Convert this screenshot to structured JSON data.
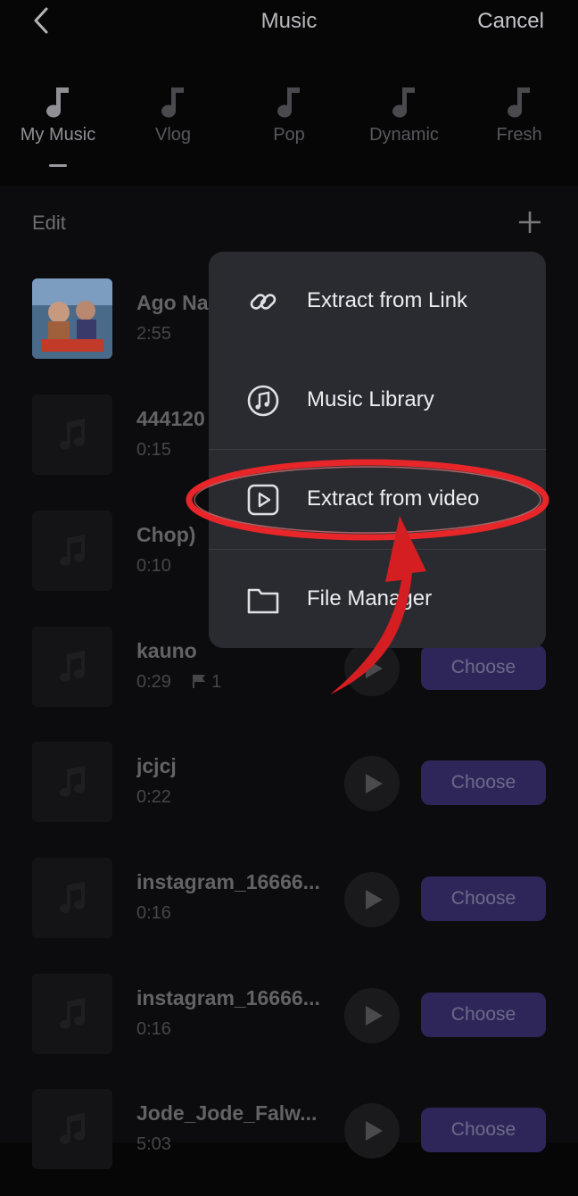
{
  "header": {
    "title": "Music",
    "cancel_label": "Cancel"
  },
  "tabs": [
    {
      "label": "My Music",
      "active": true
    },
    {
      "label": "Vlog"
    },
    {
      "label": "Pop"
    },
    {
      "label": "Dynamic"
    },
    {
      "label": "Fresh"
    }
  ],
  "toolbar": {
    "edit_label": "Edit"
  },
  "tracks": [
    {
      "title": "Ago Na",
      "duration": "2:55"
    },
    {
      "title": "444120",
      "duration": "0:15"
    },
    {
      "title": "Chop)",
      "duration": "0:10"
    },
    {
      "title": "kauno",
      "duration": "0:29",
      "marker_count": "1",
      "choose_label": "Choose"
    },
    {
      "title": "jcjcj",
      "duration": "0:22",
      "choose_label": "Choose"
    },
    {
      "title": "instagram_16666...",
      "duration": "0:16",
      "choose_label": "Choose"
    },
    {
      "title": "instagram_16666...",
      "duration": "0:16",
      "choose_label": "Choose"
    },
    {
      "title": "Jode_Jode_Falw...",
      "duration": "5:03",
      "choose_label": "Choose"
    }
  ],
  "menu": {
    "items": [
      {
        "label": "Extract from Link",
        "icon": "link-icon"
      },
      {
        "label": "Music Library",
        "icon": "music-note-circle-icon"
      },
      {
        "label": "Extract from video",
        "icon": "video-play-icon"
      },
      {
        "label": "File Manager",
        "icon": "folder-icon"
      }
    ]
  },
  "colors": {
    "accent": "#2e2659",
    "annotation": "#e8262a",
    "menu_bg": "#2a2b30"
  }
}
